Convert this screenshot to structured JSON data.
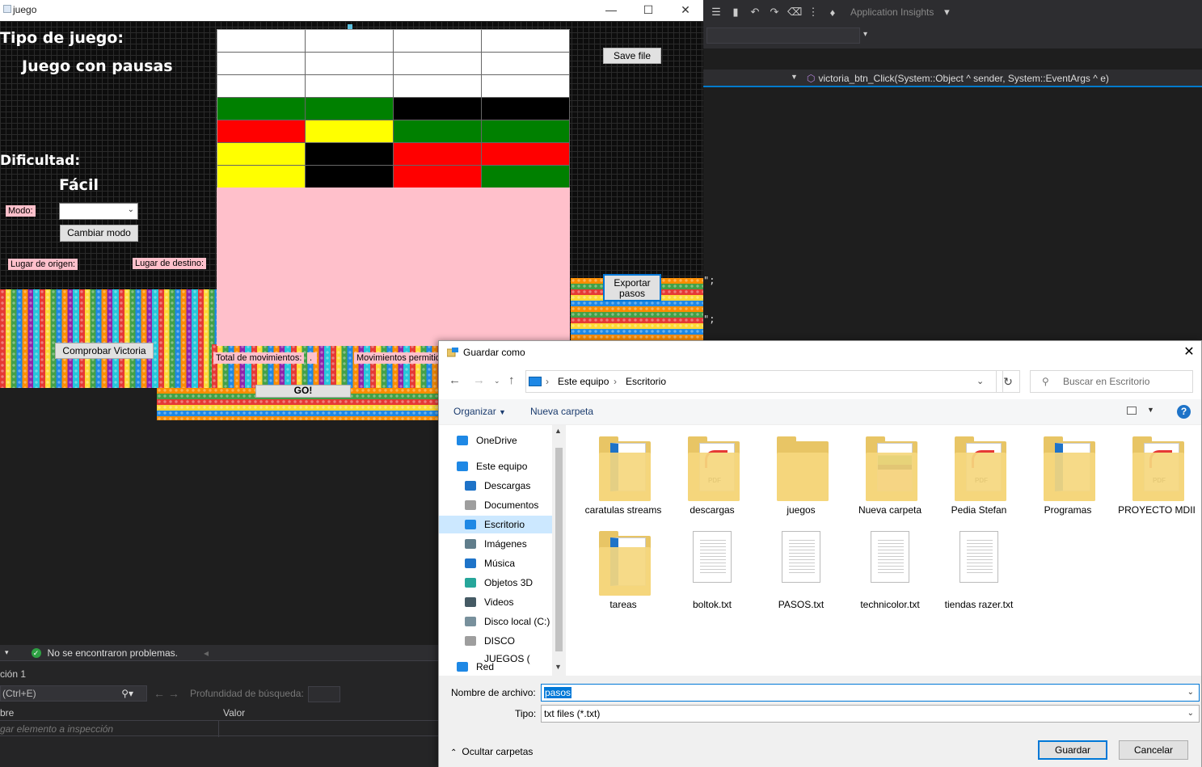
{
  "vs": {
    "application_insights": "Application Insights",
    "nav_method": "victoria_btn_Click(System::Object ^ sender, System::EventArgs ^ e)",
    "code_fragment_1": "\";",
    "code_fragment_2": "\";",
    "status_text": "No se encontraron problemas.",
    "watch": {
      "title": "ción 1",
      "search_placeholder": "(Ctrl+E)",
      "depth_label": "Profundidad de búsqueda:",
      "col_name": "bre",
      "col_value": "Valor",
      "add_hint": "gar elemento a inspección"
    }
  },
  "game": {
    "window_title": "juego",
    "tipo_label": "Tipo de juego:",
    "tipo_value": "Juego con pausas",
    "dificultad_label": "Dificultad:",
    "dificultad_value": "Fácil",
    "modo_label": "Modo:",
    "cambiar_modo": "Cambiar modo",
    "lugar_origen": "Lugar de origen:",
    "lugar_destino": "Lugar de destino:",
    "comprobar_victoria": "Comprobar Victoria",
    "total_movimientos": "Total de movimientos:",
    "total_value": ".",
    "movimientos_permitidos": "Movimientos permitido",
    "go_button": "GO!",
    "save_file": "Save file",
    "exportar_pasos": "Exportar pasos",
    "board_colors": [
      [
        "#ffffff",
        "#ffffff",
        "#ffffff",
        "#ffffff"
      ],
      [
        "#ffffff",
        "#ffffff",
        "#ffffff",
        "#ffffff"
      ],
      [
        "#ffffff",
        "#ffffff",
        "#ffffff",
        "#ffffff"
      ],
      [
        "#008000",
        "#008000",
        "#000000",
        "#000000"
      ],
      [
        "#ff0000",
        "#ffff00",
        "#008000",
        "#008000"
      ],
      [
        "#ffff00",
        "#000000",
        "#ff0000",
        "#ff0000"
      ],
      [
        "#ffff00",
        "#000000",
        "#ff0000",
        "#008000"
      ]
    ]
  },
  "dialog": {
    "title": "Guardar como",
    "path": [
      "Este equipo",
      "Escritorio"
    ],
    "search_placeholder": "Buscar en Escritorio",
    "organizar": "Organizar",
    "nueva_carpeta": "Nueva carpeta",
    "tree": [
      {
        "label": "OneDrive",
        "icon": "cloud-icon",
        "color": "#1e88e5"
      },
      {
        "label": "Este equipo",
        "icon": "computer-icon",
        "color": "#1e88e5"
      },
      {
        "label": "Descargas",
        "icon": "download-icon",
        "color": "#1e73c8"
      },
      {
        "label": "Documentos",
        "icon": "documents-icon",
        "color": "#9e9e9e"
      },
      {
        "label": "Escritorio",
        "icon": "desktop-icon",
        "color": "#1e88e5",
        "selected": true
      },
      {
        "label": "Imágenes",
        "icon": "pictures-icon",
        "color": "#607d8b"
      },
      {
        "label": "Música",
        "icon": "music-icon",
        "color": "#1e73c8"
      },
      {
        "label": "Objetos 3D",
        "icon": "cube-icon",
        "color": "#26a69a"
      },
      {
        "label": "Videos",
        "icon": "video-icon",
        "color": "#455a64"
      },
      {
        "label": "Disco local (C:)",
        "icon": "drive-icon",
        "color": "#78909c"
      },
      {
        "label": "DISCO JUEGOS (",
        "icon": "drive-icon",
        "color": "#9e9e9e"
      },
      {
        "label": "Red",
        "icon": "network-icon",
        "color": "#1e88e5"
      }
    ],
    "files": [
      {
        "label": "caratulas streams",
        "kind": "folder-docs"
      },
      {
        "label": "descargas",
        "kind": "folder-pdf"
      },
      {
        "label": "juegos",
        "kind": "folder"
      },
      {
        "label": "Nueva carpeta",
        "kind": "folder-image"
      },
      {
        "label": "Pedia Stefan",
        "kind": "folder-pdf"
      },
      {
        "label": "Programas",
        "kind": "folder-docs"
      },
      {
        "label": "PROYECTO MDII",
        "kind": "folder-pdf"
      },
      {
        "label": "tareas",
        "kind": "folder-docs"
      },
      {
        "label": "boltok.txt",
        "kind": "txt"
      },
      {
        "label": "PASOS.txt",
        "kind": "txt"
      },
      {
        "label": "technicolor.txt",
        "kind": "txt"
      },
      {
        "label": "tiendas razer.txt",
        "kind": "txt"
      }
    ],
    "filename_label": "Nombre de archivo:",
    "filename_value": "pasos",
    "type_label": "Tipo:",
    "type_value": "txt files (*.txt)",
    "hide_folders": "Ocultar carpetas",
    "save_button": "Guardar",
    "cancel_button": "Cancelar",
    "pdf_tag": "PDF"
  }
}
